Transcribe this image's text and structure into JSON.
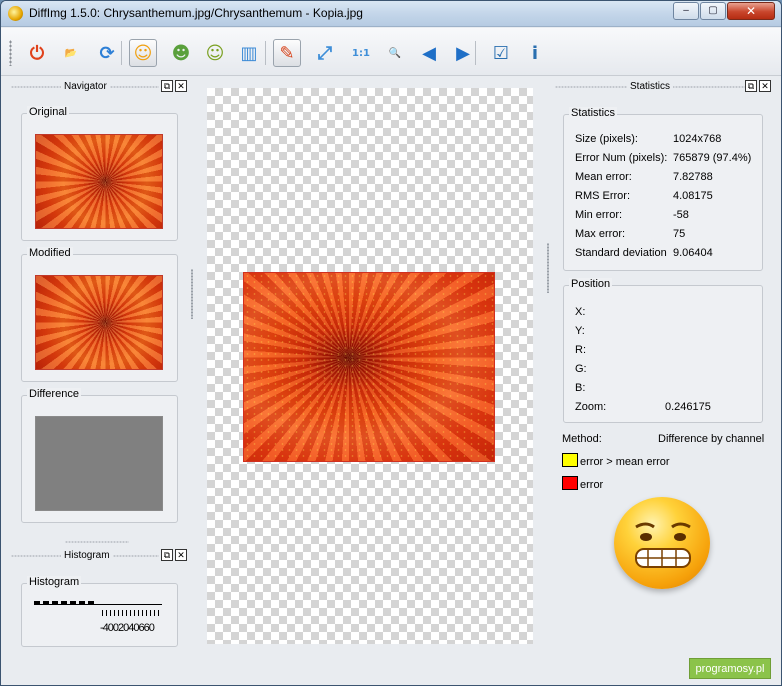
{
  "window": {
    "title": "DiffImg 1.5.0: Chrysanthemum.jpg/Chrysanthemum - Kopia.jpg",
    "minimize": "–",
    "maximize": "▢",
    "close": "✕"
  },
  "toolbar": {
    "buttons": [
      {
        "name": "quit-icon",
        "glyph": "⏻",
        "color": "#e0421c"
      },
      {
        "name": "open-folder-icon",
        "glyph": "📂",
        "color": "#e8b830"
      },
      {
        "name": "refresh-icon",
        "glyph": "⟳",
        "color": "#2d7fd6"
      },
      {
        "name": "smiley-mode-icon",
        "glyph": "☺",
        "color": "#f0a010"
      },
      {
        "name": "alien-icon",
        "glyph": "☻",
        "color": "#5aa03c"
      },
      {
        "name": "smiley-eyes-icon",
        "glyph": "☺",
        "color": "#7aa021"
      },
      {
        "name": "layout-icon",
        "glyph": "▥",
        "color": "#3d8bd6"
      },
      {
        "name": "color-select-icon",
        "glyph": "✎",
        "color": "#d8431a"
      },
      {
        "name": "zoom-fit-icon",
        "glyph": "⤢",
        "color": "#3e8ed8"
      },
      {
        "name": "zoom-original-icon",
        "glyph": "1:1",
        "color": "#3e8ed8"
      },
      {
        "name": "zoom-icon",
        "glyph": "🔍",
        "color": "#3e8ed8"
      },
      {
        "name": "previous-icon",
        "glyph": "◀",
        "color": "#1f6fc7"
      },
      {
        "name": "next-icon",
        "glyph": "▶",
        "color": "#1f6fc7"
      },
      {
        "name": "checklist-icon",
        "glyph": "☑",
        "color": "#2a6fb0"
      },
      {
        "name": "about-icon",
        "glyph": "i",
        "color": "#2a6fb0"
      }
    ]
  },
  "navigator": {
    "title": "Navigator",
    "original_label": "Original",
    "modified_label": "Modified",
    "difference_label": "Difference"
  },
  "histogram": {
    "title": "Histogram",
    "group_label": "Histogram",
    "tick_labels": "-4002040660"
  },
  "statistics": {
    "panel_title": "Statistics",
    "group_label": "Statistics",
    "rows": [
      {
        "label": "Size (pixels):",
        "value": "1024x768"
      },
      {
        "label": "Error Num (pixels):",
        "value": "765879 (97.4%)"
      },
      {
        "label": "Mean error:",
        "value": "7.82788"
      },
      {
        "label": "RMS Error:",
        "value": "4.08175"
      },
      {
        "label": "Min error:",
        "value": "-58"
      },
      {
        "label": "Max error:",
        "value": "75"
      },
      {
        "label": "Standard deviation",
        "value": "9.06404"
      }
    ]
  },
  "position": {
    "group_label": "Position",
    "rows": [
      {
        "label": "X:",
        "value": ""
      },
      {
        "label": "Y:",
        "value": ""
      },
      {
        "label": "R:",
        "value": ""
      },
      {
        "label": "G:",
        "value": ""
      },
      {
        "label": "B:",
        "value": ""
      },
      {
        "label": "Zoom:",
        "value": "0.246175"
      }
    ]
  },
  "method": {
    "label": "Method:",
    "value": "Difference by channel"
  },
  "legend": {
    "above_mean": {
      "text": "error > mean error",
      "color": "#ffff00"
    },
    "error": {
      "text": "error",
      "color": "#ff0000"
    }
  },
  "watermark": "programosy.pl"
}
